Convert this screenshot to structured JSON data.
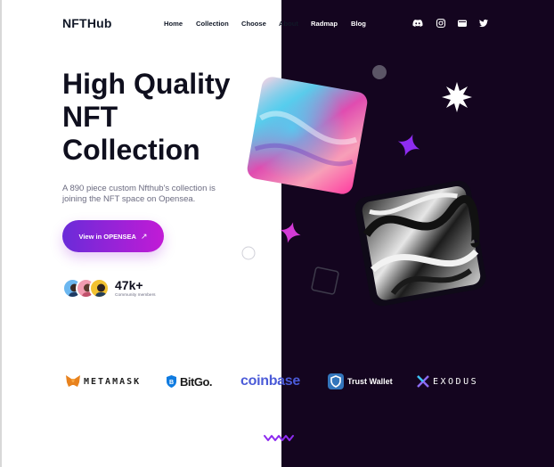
{
  "brand": {
    "logo": "NFTHub"
  },
  "nav": {
    "items": [
      {
        "label": "Home"
      },
      {
        "label": "Collection"
      },
      {
        "label": "Choose"
      },
      {
        "label": "About"
      },
      {
        "label": "Radmap"
      },
      {
        "label": "Blog"
      }
    ]
  },
  "socials": [
    "discord-icon",
    "instagram-icon",
    "wallet-icon",
    "twitter-icon"
  ],
  "hero": {
    "title_lines": [
      "High Quality",
      "NFT",
      "Collection"
    ],
    "description": "A 890 piece custom Nfthub's collection is joining the NFT space on Opensea.",
    "cta_label": "View in OPENSEA",
    "cta_icon": "arrow-up-right-icon"
  },
  "community": {
    "value": "47k+",
    "label": "Community members"
  },
  "partners": {
    "metamask": "METAMASK",
    "bitgo": "BitGo.",
    "coinbase": "coinbase",
    "trust": "Trust Wallet",
    "exodus": "EXODUS"
  },
  "colors": {
    "dark_bg": "#14051f",
    "accent_start": "#6a2bd8",
    "accent_end": "#c21bd6",
    "text_dark": "#0f0f1e",
    "star_purple": "#8e2cf0",
    "star_pink": "#d43ad6"
  }
}
